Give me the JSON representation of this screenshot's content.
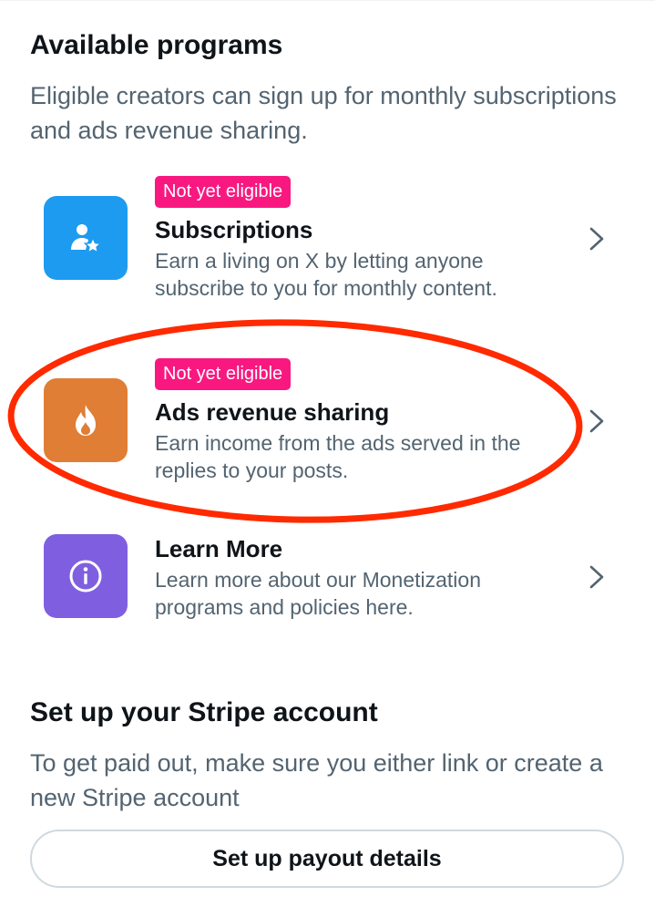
{
  "available_programs": {
    "title": "Available programs",
    "description": "Eligible creators can sign up for monthly subscriptions and ads revenue sharing."
  },
  "programs": [
    {
      "badge": "Not yet eligible",
      "title": "Subscriptions",
      "description": "Earn a living on X by letting anyone subscribe to you for monthly content.",
      "icon": "person-star-icon",
      "color": "#1d9bf0"
    },
    {
      "badge": "Not yet eligible",
      "title": "Ads revenue sharing",
      "description": "Earn income from the ads served in the replies to your posts.",
      "icon": "flame-icon",
      "color": "#e07e35"
    },
    {
      "title": "Learn More",
      "description": "Learn more about our Monetization programs and policies here.",
      "icon": "info-icon",
      "color": "#7f5fe0"
    }
  ],
  "stripe": {
    "title": "Set up your Stripe account",
    "description": "To get paid out, make sure you either link or create a new Stripe account",
    "button_label": "Set up payout details"
  },
  "colors": {
    "badge": "#f91880",
    "highlight_annotation": "#ff2a00",
    "secondary_text": "#536471"
  }
}
